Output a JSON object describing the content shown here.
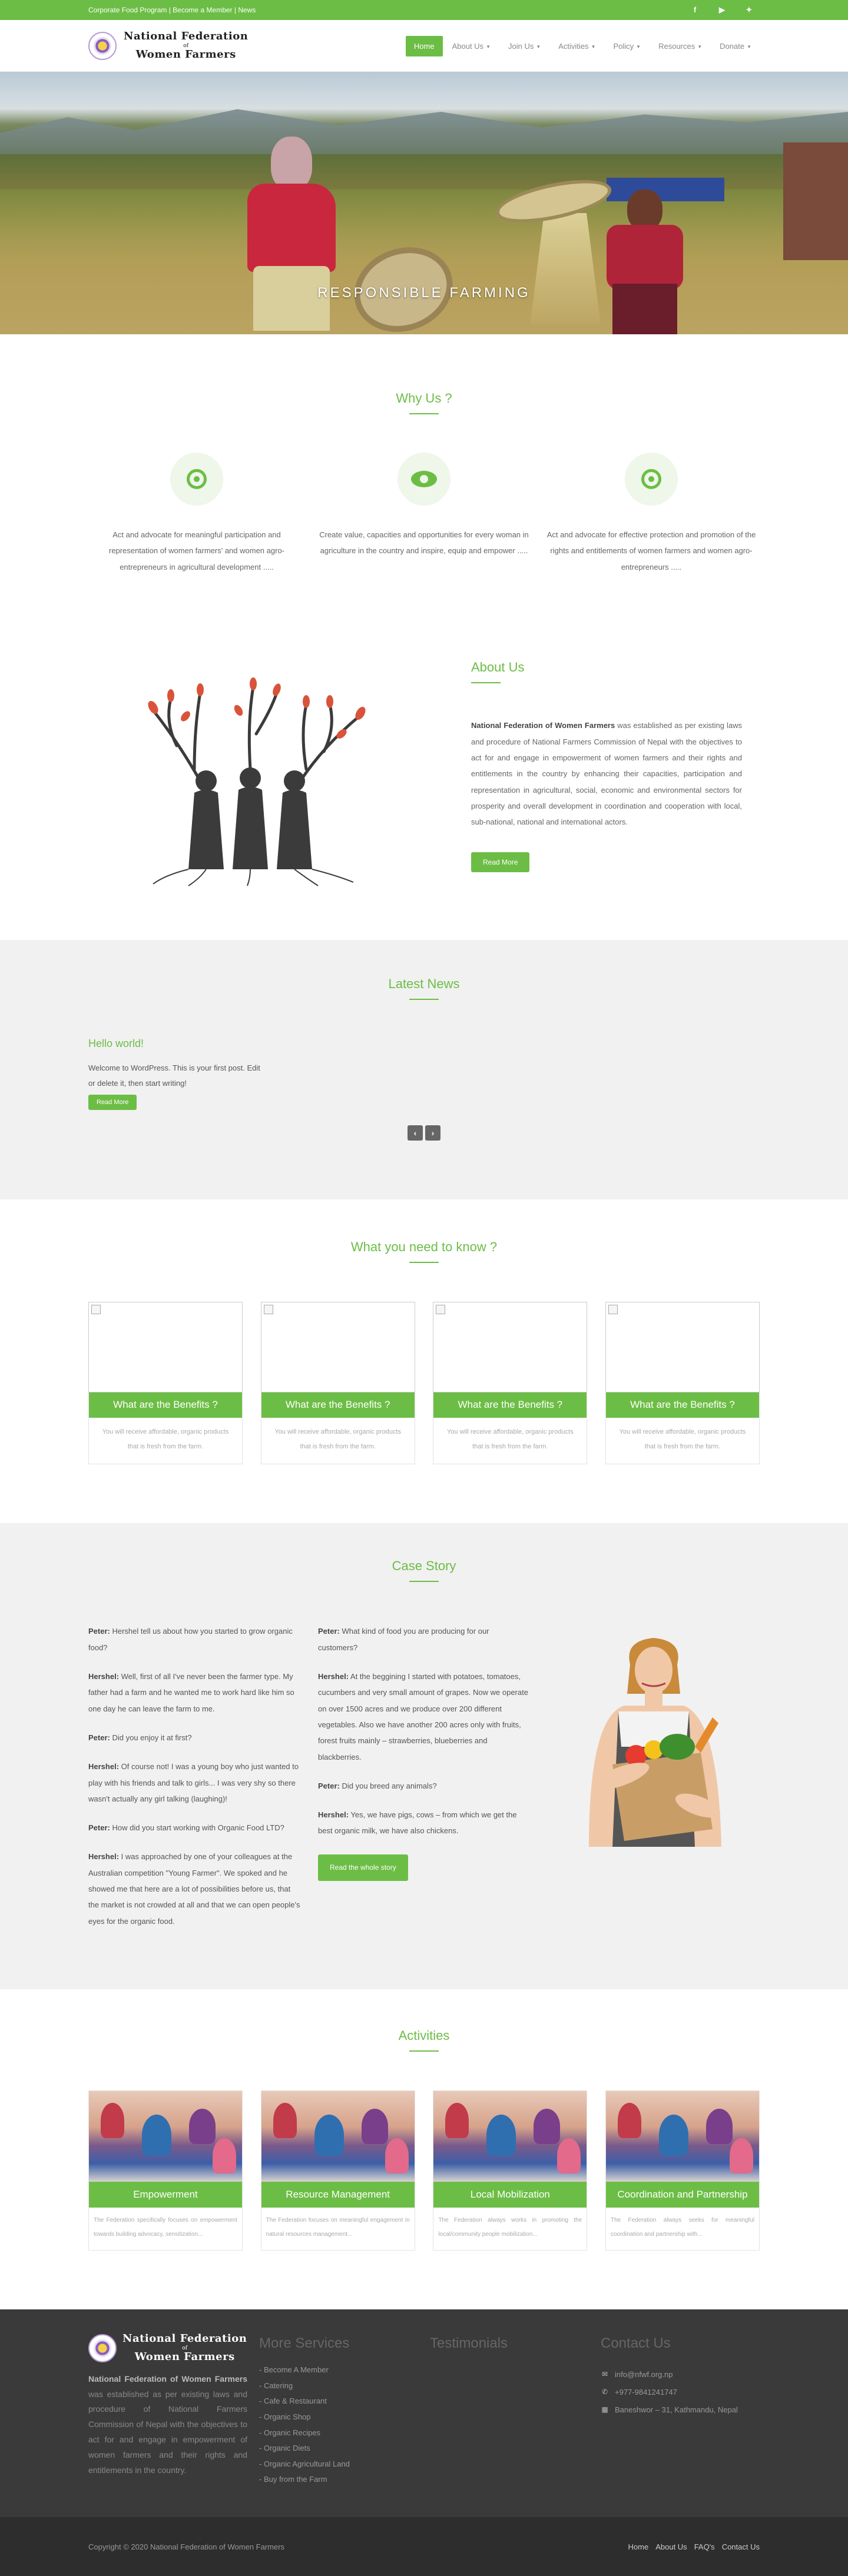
{
  "topbar": {
    "links_text": "Corporate Food Program | Become a Member | News",
    "social": [
      {
        "icon": "facebook-icon",
        "glyph": "f"
      },
      {
        "icon": "youtube-icon",
        "glyph": "▶"
      },
      {
        "icon": "twitter-icon",
        "glyph": "✦"
      }
    ]
  },
  "header": {
    "brand_line1": "National Federation",
    "brand_line2": "of",
    "brand_line3": "Women Farmers",
    "nav": [
      {
        "label": "Home",
        "active": true,
        "dropdown": false
      },
      {
        "label": "About Us",
        "active": false,
        "dropdown": true
      },
      {
        "label": "Join Us",
        "active": false,
        "dropdown": true
      },
      {
        "label": "Activities",
        "active": false,
        "dropdown": true
      },
      {
        "label": "Policy",
        "active": false,
        "dropdown": true
      },
      {
        "label": "Resources",
        "active": false,
        "dropdown": true
      },
      {
        "label": "Donate",
        "active": false,
        "dropdown": true
      }
    ]
  },
  "hero": {
    "caption": "RESPONSIBLE FARMING"
  },
  "why": {
    "title": "Why Us ?",
    "items": [
      {
        "icon": "target-icon",
        "text": "Act and advocate for meaningful participation and representation of women farmers' and women agro-entrepreneurs in agricultural development ....."
      },
      {
        "icon": "eye-icon",
        "text": "Create value, capacities and opportunities for every woman in agriculture in the country and inspire, equip and empower ....."
      },
      {
        "icon": "target-icon",
        "text": "Act and advocate for effective protection and promotion of the rights and entitlements of women farmers and women agro-entrepreneurs ....."
      }
    ]
  },
  "about": {
    "title": "About Us",
    "org_name": "National Federation of Women Farmers",
    "text": " was established as per existing laws and procedure of National Farmers Commission of Nepal with the objectives to act for and engage in empowerment of women farmers and their rights and entitlements in the country by enhancing their capacities, participation and representation in agricultural, social, economic and environmental sectors for prosperity and overall development in coordination and cooperation with local, sub-national, national and international actors.",
    "button": "Read More"
  },
  "news": {
    "title": "Latest News",
    "post_title": "Hello world!",
    "post_text": "Welcome to WordPress. This is your first post. Edit or delete it, then start writing!",
    "button": "Read More",
    "prev": "‹",
    "next": "›"
  },
  "know": {
    "title": "What you need to know ?",
    "cards": [
      {
        "heading": "What are the Benefits ?",
        "text": "You will receive affordable, organic products that is fresh from the farm."
      },
      {
        "heading": "What are the Benefits ?",
        "text": "You will receive affordable, organic products that is fresh from the farm."
      },
      {
        "heading": "What are the Benefits ?",
        "text": "You will receive affordable, organic products that is fresh from the farm."
      },
      {
        "heading": "What are the Benefits ?",
        "text": "You will receive affordable, organic products that is fresh from the farm."
      }
    ]
  },
  "case": {
    "title": "Case Story",
    "col1": [
      {
        "speaker": "Peter:",
        "text": " Hershel tell us about how you started to grow organic food?"
      },
      {
        "speaker": "Hershel:",
        "text": " Well, first of all I've never been the farmer type. My father had a farm and he wanted me to work hard like him so one day he can leave the farm to me."
      },
      {
        "speaker": "Peter:",
        "text": " Did you enjoy it at first?"
      },
      {
        "speaker": "Hershel:",
        "text": " Of course not! I was a young boy who just wanted to play with his friends and talk to girls... I was very shy so there wasn't actually any girl talking (laughing)!"
      },
      {
        "speaker": "Peter:",
        "text": " How did you start working with Organic Food LTD?"
      },
      {
        "speaker": "Hershel:",
        "text": " I was approached by one of your colleagues at the Australian competition \"Young Farmer\". We spoked and he showed me that here are a lot of possibilities before us, that the market is not crowded at all and that we can open people's eyes for the organic food."
      }
    ],
    "col2": [
      {
        "speaker": "Peter:",
        "text": " What kind of food you are producing for our customers?"
      },
      {
        "speaker": "Hershel:",
        "text": " At the beggining I started with potatoes, tomatoes, cucumbers and very small amount of grapes. Now we operate on over 1500 acres and we produce over 200 different vegetables. Also we have another 200 acres only with fruits, forest fruits mainly – strawberries, blueberries and blackberries."
      },
      {
        "speaker": "Peter:",
        "text": " Did you breed any animals?"
      },
      {
        "speaker": "Hershel:",
        "text": " Yes, we have pigs, cows – from which we get the best organic milk, we have also chickens."
      }
    ],
    "button": "Read the whole story"
  },
  "activities": {
    "title": "Activities",
    "cards": [
      {
        "heading": "Empowerment",
        "text": "The Federation specifically focuses on empowerment towards building advocacy, sensitization..."
      },
      {
        "heading": "Resource Management",
        "text": "The Federation focuses on meaningful engagement in natural resources management..."
      },
      {
        "heading": "Local Mobilization",
        "text": "The Federation always works in promoting the local/community people mobilization..."
      },
      {
        "heading": "Coordination and Partnership",
        "text": "The Federation always seeks for meaningful coordination and partnership with..."
      }
    ]
  },
  "footer": {
    "brand_line1": "National Federation",
    "brand_line2": "of",
    "brand_line3": "Women Farmers",
    "about_bold": "National Federation of Women Farmers",
    "about_text": " was established as per existing laws and procedure of National Farmers Commission of Nepal with the objectives to act for and engage in empowerment of women farmers and their rights and entitlements in the country.",
    "services_title": "More Services",
    "services": [
      "Become A Member",
      "Catering",
      "Cafe & Restaurant",
      "Organic Shop",
      "Organic Recipes",
      "Organic Diets",
      "Organic Agricultural Land",
      "Buy from the Farm"
    ],
    "testimonials_title": "Testimonials",
    "contact_title": "Contact Us",
    "contacts": [
      {
        "icon": "envelope-icon",
        "glyph": "✉",
        "text": "info@nfwf.org.np"
      },
      {
        "icon": "phone-icon",
        "glyph": "✆",
        "text": "+977-9841241747"
      },
      {
        "icon": "building-icon",
        "glyph": "▦",
        "text": "Baneshwor – 31, Kathmandu, Nepal"
      }
    ],
    "copyright": "Copyright © 2020 National Federation of Women Farmers",
    "bottom_links": [
      "Home",
      "About Us",
      "FAQ's",
      "Contact Us"
    ]
  },
  "colors": {
    "accent": "#6cbd45",
    "footer_bg": "#3a3a3a",
    "copyright_bg": "#2d2d2d",
    "section_gray": "#f1f1f1"
  }
}
